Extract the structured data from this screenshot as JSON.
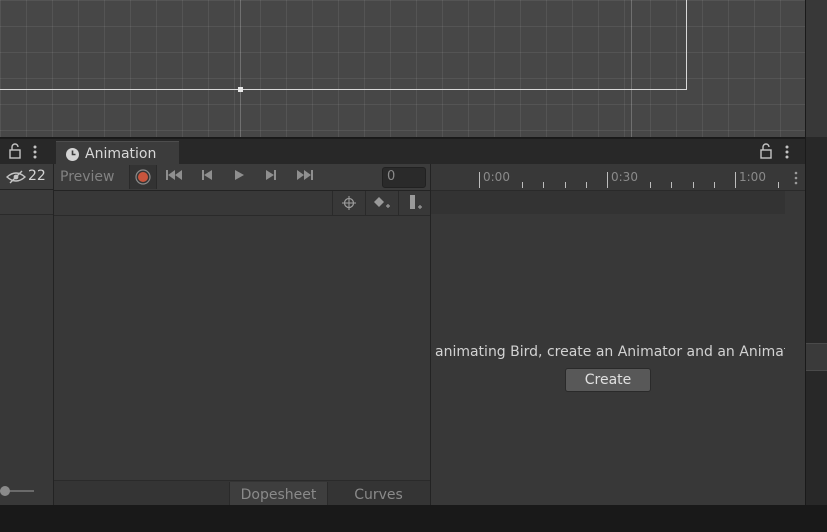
{
  "left_panel": {
    "hidden_count": "22"
  },
  "animation": {
    "tab_label": "Animation",
    "preview_label": "Preview",
    "frame_value": "0",
    "time_labels": [
      "0:00",
      "0:30",
      "1:00"
    ],
    "message": "animating Bird, create an Animator and an Animat",
    "create_label": "Create",
    "dopesheet_label": "Dopesheet",
    "curves_label": "Curves"
  },
  "colors": {
    "record": "#c8553d",
    "panel_bg": "#383838",
    "toolbar_bg": "#3c3c3c",
    "scene_bg": "#474747"
  },
  "icons": {
    "lock": "lock-icon",
    "menu": "kebab-menu-icon",
    "visibility": "eye-hidden-icon",
    "clock": "clock-icon",
    "record": "record-icon",
    "first_key": "first-key-icon",
    "prev_key": "prev-key-icon",
    "play": "play-icon",
    "next_key": "next-key-icon",
    "last_key": "last-key-icon",
    "filter": "filter-icon",
    "add_keyframe": "add-keyframe-icon",
    "add_event": "add-event-icon"
  }
}
